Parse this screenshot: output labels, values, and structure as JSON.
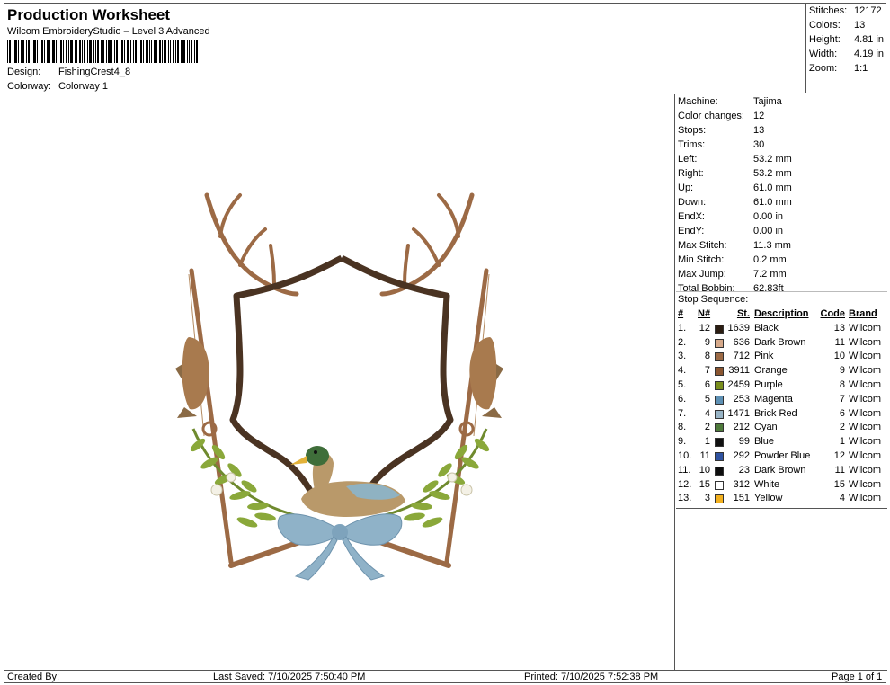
{
  "header": {
    "title": "Production Worksheet",
    "subtitle": "Wilcom EmbroideryStudio – Level 3 Advanced",
    "design_label": "Design:",
    "design_value": "FishingCrest4_8",
    "colorway_label": "Colorway:",
    "colorway_value": "Colorway 1"
  },
  "summary": {
    "stitches": {
      "label": "Stitches:",
      "value": "12172"
    },
    "colors": {
      "label": "Colors:",
      "value": "13"
    },
    "height": {
      "label": "Height:",
      "value": "4.81 in"
    },
    "width": {
      "label": "Width:",
      "value": "4.19 in"
    },
    "zoom": {
      "label": "Zoom:",
      "value": "1:1"
    }
  },
  "info": {
    "machine": {
      "label": "Machine:",
      "value": "Tajima"
    },
    "color_changes": {
      "label": "Color changes:",
      "value": "12"
    },
    "stops": {
      "label": "Stops:",
      "value": "13"
    },
    "trims": {
      "label": "Trims:",
      "value": "30"
    },
    "left": {
      "label": "Left:",
      "value": "53.2 mm"
    },
    "right": {
      "label": "Right:",
      "value": "53.2 mm"
    },
    "up": {
      "label": "Up:",
      "value": "61.0 mm"
    },
    "down": {
      "label": "Down:",
      "value": "61.0 mm"
    },
    "endx": {
      "label": "EndX:",
      "value": "0.00 in"
    },
    "endy": {
      "label": "EndY:",
      "value": "0.00 in"
    },
    "max_stitch": {
      "label": "Max Stitch:",
      "value": "11.3 mm"
    },
    "min_stitch": {
      "label": "Min Stitch:",
      "value": "0.2 mm"
    },
    "max_jump": {
      "label": "Max Jump:",
      "value": "7.2 mm"
    },
    "total_bobbin": {
      "label": "Total Bobbin:",
      "value": "62.83ft"
    }
  },
  "stop_sequence": {
    "title": "Stop Sequence:",
    "columns": {
      "idx": "#",
      "n": "N#",
      "st": "St.",
      "desc": "Description",
      "code": "Code",
      "brand": "Brand"
    },
    "rows": [
      {
        "idx": "1.",
        "n": "12",
        "color": "#2b1d12",
        "st": "1639",
        "desc": "Black",
        "code": "13",
        "brand": "Wilcom"
      },
      {
        "idx": "2.",
        "n": "9",
        "color": "#d6a98a",
        "st": "636",
        "desc": "Dark Brown",
        "code": "11",
        "brand": "Wilcom"
      },
      {
        "idx": "3.",
        "n": "8",
        "color": "#9c6a45",
        "st": "712",
        "desc": "Pink",
        "code": "10",
        "brand": "Wilcom"
      },
      {
        "idx": "4.",
        "n": "7",
        "color": "#8a5530",
        "st": "3911",
        "desc": "Orange",
        "code": "9",
        "brand": "Wilcom"
      },
      {
        "idx": "5.",
        "n": "6",
        "color": "#7a8f1c",
        "st": "2459",
        "desc": "Purple",
        "code": "8",
        "brand": "Wilcom"
      },
      {
        "idx": "6.",
        "n": "5",
        "color": "#5d90b4",
        "st": "253",
        "desc": "Magenta",
        "code": "7",
        "brand": "Wilcom"
      },
      {
        "idx": "7.",
        "n": "4",
        "color": "#98b4c6",
        "st": "1471",
        "desc": "Brick Red",
        "code": "6",
        "brand": "Wilcom"
      },
      {
        "idx": "8.",
        "n": "2",
        "color": "#4e7a3b",
        "st": "212",
        "desc": "Cyan",
        "code": "2",
        "brand": "Wilcom"
      },
      {
        "idx": "9.",
        "n": "1",
        "color": "#111111",
        "st": "99",
        "desc": "Blue",
        "code": "1",
        "brand": "Wilcom"
      },
      {
        "idx": "10.",
        "n": "11",
        "color": "#2f52a0",
        "st": "292",
        "desc": "Powder Blue",
        "code": "12",
        "brand": "Wilcom"
      },
      {
        "idx": "11.",
        "n": "10",
        "color": "#0e0e0e",
        "st": "23",
        "desc": "Dark Brown",
        "code": "11",
        "brand": "Wilcom"
      },
      {
        "idx": "12.",
        "n": "15",
        "color": "#ffffff",
        "st": "312",
        "desc": "White",
        "code": "15",
        "brand": "Wilcom"
      },
      {
        "idx": "13.",
        "n": "3",
        "color": "#f2b01e",
        "st": "151",
        "desc": "Yellow",
        "code": "4",
        "brand": "Wilcom"
      }
    ]
  },
  "footer": {
    "created_by": "Created By:",
    "last_saved": "Last Saved: 7/10/2025 7:50:40 PM",
    "printed": "Printed: 7/10/2025 7:52:38 PM",
    "page": "Page 1 of 1"
  }
}
